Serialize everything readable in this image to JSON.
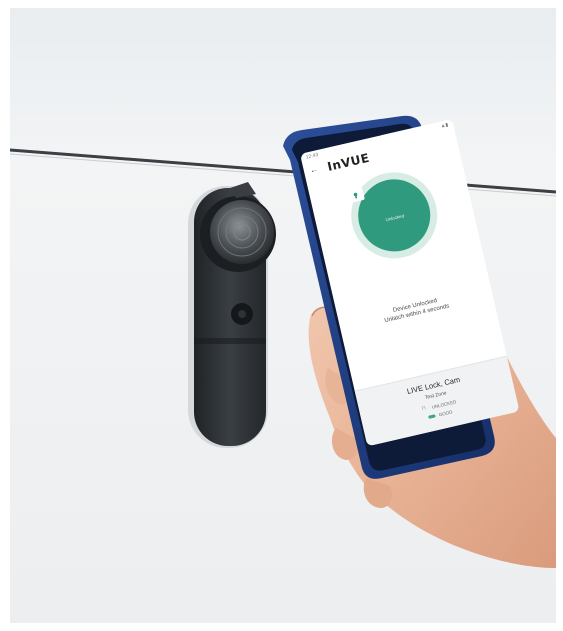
{
  "phone": {
    "status_time": "12:43",
    "brand": "InVUE",
    "lock_state_label": "Unlocked",
    "message_line1": "Device Unlocked",
    "message_line2": "Unlatch within 4 seconds",
    "device_name": "LIVE Lock, Cam",
    "zone_name": "Test Zone",
    "lock_status": "UNLOCKED",
    "battery_status": "GOOD"
  },
  "colors": {
    "accent": "#2f9a7d",
    "phone_body": "#1f3f86",
    "lock_body": "#2f3337"
  },
  "icons": [
    "back-arrow-icon",
    "padlock-open-icon",
    "lock-icon",
    "battery-icon"
  ]
}
